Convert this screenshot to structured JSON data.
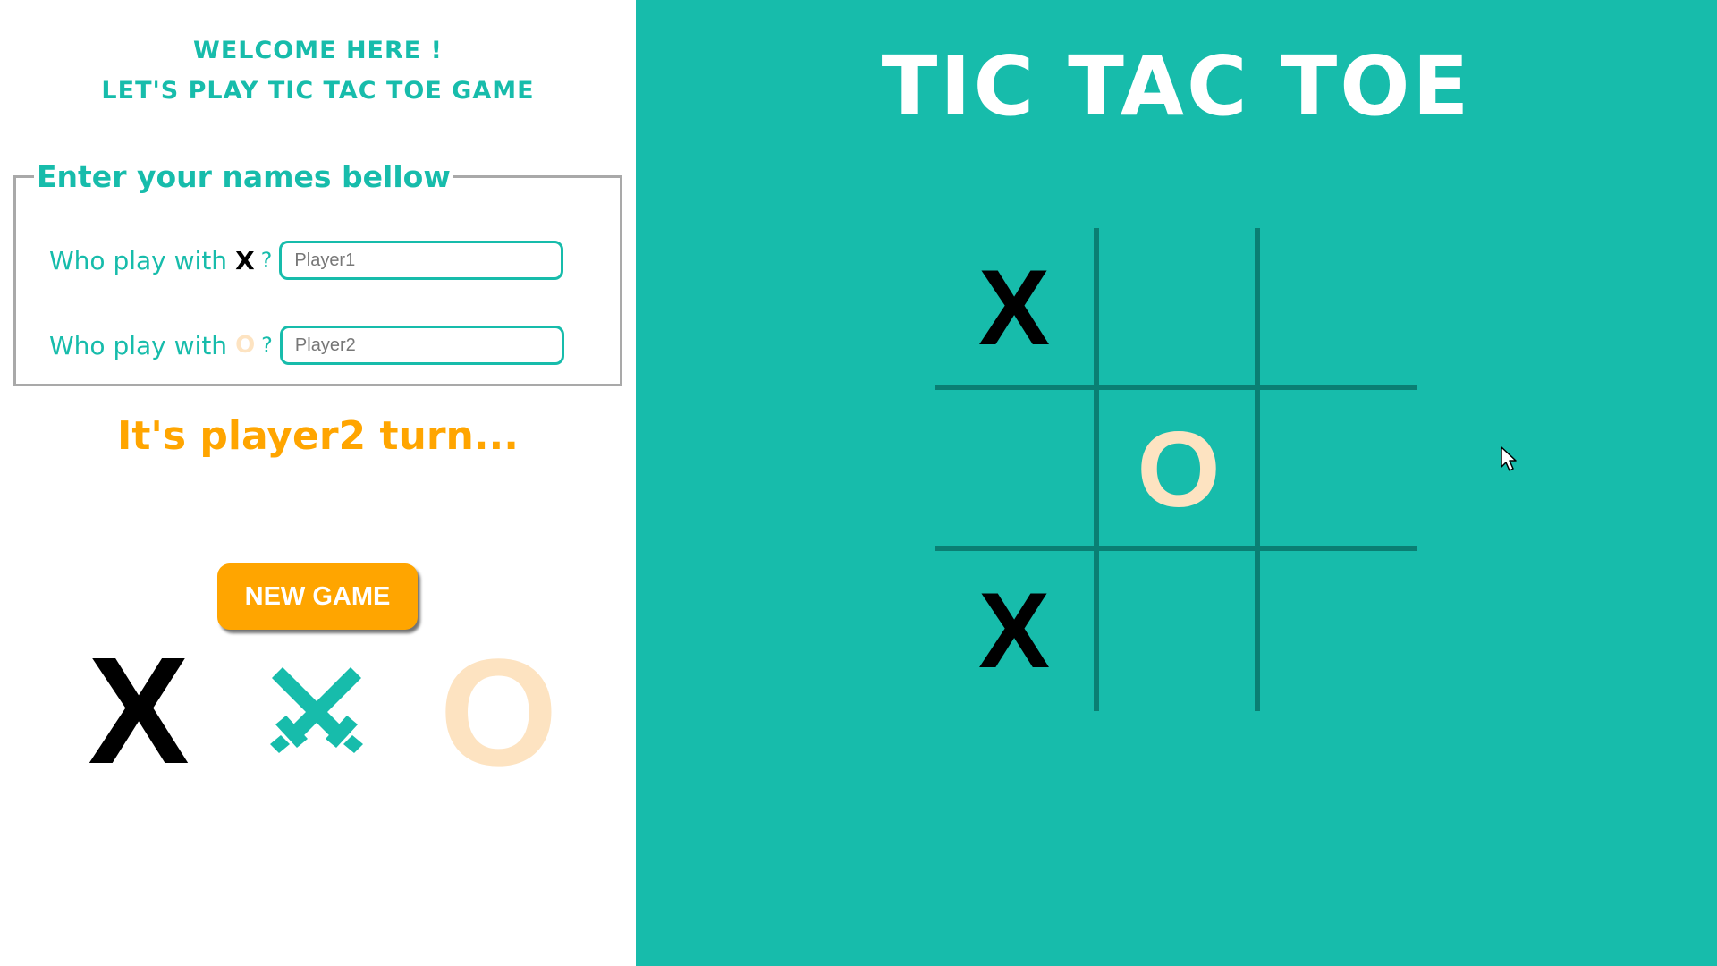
{
  "header": {
    "welcome_line1": "Welcome here !",
    "welcome_line2": "Let's play tic tac toe game"
  },
  "names_form": {
    "legend": "Enter your names bellow",
    "player_x": {
      "question": "Who play with",
      "symbol": "X",
      "question_mark": "?",
      "value": "",
      "placeholder": "Player1"
    },
    "player_o": {
      "question": "Who play with",
      "symbol": "O",
      "question_mark": "?",
      "value": "",
      "placeholder": "Player2"
    }
  },
  "status": {
    "turn_text": "It's player2 turn..."
  },
  "controls": {
    "new_game_label": "NEW GAME"
  },
  "versus": {
    "left_symbol": "X",
    "middle_icon": "crossed-swords-icon",
    "right_symbol": "O"
  },
  "game": {
    "title": "Tic Tac Toe",
    "board": [
      [
        "X",
        "",
        ""
      ],
      [
        "",
        "O",
        ""
      ],
      [
        "X",
        "",
        ""
      ]
    ]
  },
  "colors": {
    "teal": "#17bcab",
    "dark_teal_grid": "#0a7f73",
    "orange": "#ffa500",
    "o_color": "#fde3c1",
    "x_color": "#000000",
    "white": "#ffffff"
  }
}
